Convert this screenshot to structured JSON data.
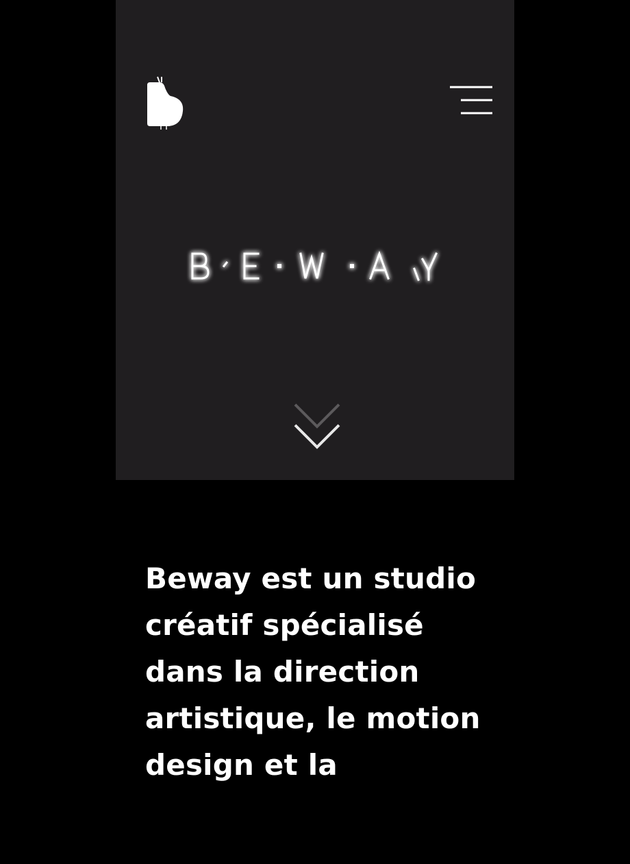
{
  "hero": {
    "background_color": "#201e20",
    "logo_icon": "beway-bird-logo-icon",
    "menu_icon": "hamburger-menu-icon",
    "wordmark": "B·E·W·A·Y",
    "scroll_icon": "double-chevron-down-icon"
  },
  "intro": {
    "text": "Beway est un studio créatif spécialisé dans la direction artistique, le motion design et la"
  },
  "colors": {
    "page_background": "#000000",
    "text": "#ffffff",
    "wordmark_glow": "#ffffff"
  }
}
